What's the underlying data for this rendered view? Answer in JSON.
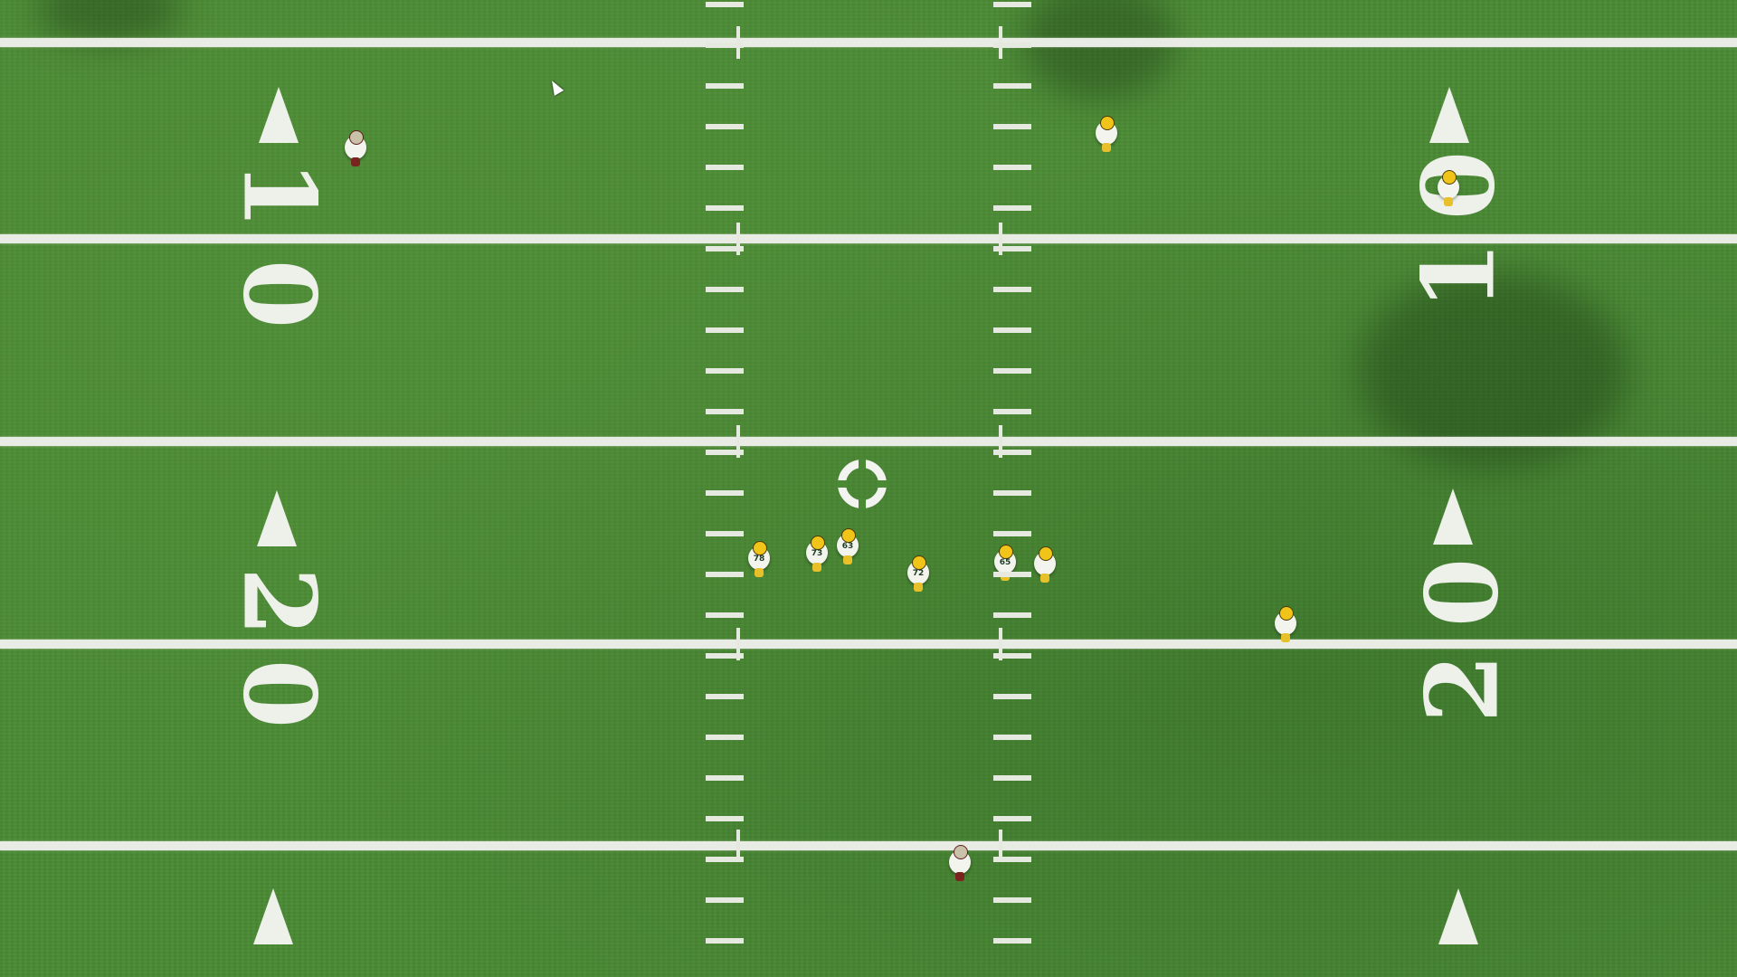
{
  "field": {
    "yard_numbers_left": [
      "1",
      "0",
      "2",
      "0"
    ],
    "yard_numbers_right": [
      "0",
      "1",
      "0",
      "2"
    ],
    "colors": {
      "turf": "#4a8a34",
      "lines": "#e9ece4",
      "home_helmet": "#f0c419",
      "home_jersey": "#f4f4ef"
    }
  },
  "players": [
    {
      "team": "offense",
      "number": "78"
    },
    {
      "team": "offense",
      "number": "73"
    },
    {
      "team": "offense",
      "number": "63"
    },
    {
      "team": "offense",
      "number": "72"
    },
    {
      "team": "offense",
      "number": "65"
    },
    {
      "team": "offense",
      "number": ""
    },
    {
      "team": "offense",
      "number": ""
    },
    {
      "team": "offense",
      "number": ""
    },
    {
      "team": "offense",
      "number": ""
    },
    {
      "team": "defense",
      "number": ""
    },
    {
      "team": "defense",
      "number": ""
    }
  ],
  "icons": {
    "ball_marker": "target-ring-icon",
    "cursor": "mouse-pointer-icon"
  }
}
